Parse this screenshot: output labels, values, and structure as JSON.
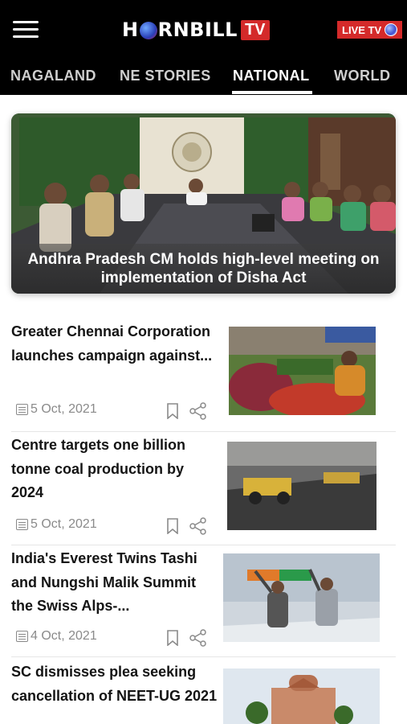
{
  "header": {
    "logo_main": "RNBILL",
    "logo_prefix": "H",
    "logo_tv": "TV",
    "live_label": "LIVE TV"
  },
  "tabs": [
    {
      "label": "NAGALAND",
      "active": false
    },
    {
      "label": "NE STORIES",
      "active": false
    },
    {
      "label": "NATIONAL",
      "active": true
    },
    {
      "label": "WORLD",
      "active": false
    }
  ],
  "hero": {
    "caption": "Andhra Pradesh CM holds high-level meeting on implementation of Disha Act"
  },
  "articles": [
    {
      "title": "Greater Chennai Corporation launches campaign against...",
      "date": "5 Oct, 2021"
    },
    {
      "title": "Centre targets one billion tonne coal production by 2024",
      "date": "5 Oct, 2021"
    },
    {
      "title": "India's Everest Twins Tashi and Nungshi Malik Summit the Swiss Alps-...",
      "date": "4 Oct, 2021"
    },
    {
      "title": "SC dismisses plea seeking cancellation of NEET-UG 2021",
      "date": ""
    }
  ],
  "colors": {
    "header_bg": "#000000",
    "brand_red": "#d42a2a",
    "meta_gray": "#8a8a8a"
  }
}
